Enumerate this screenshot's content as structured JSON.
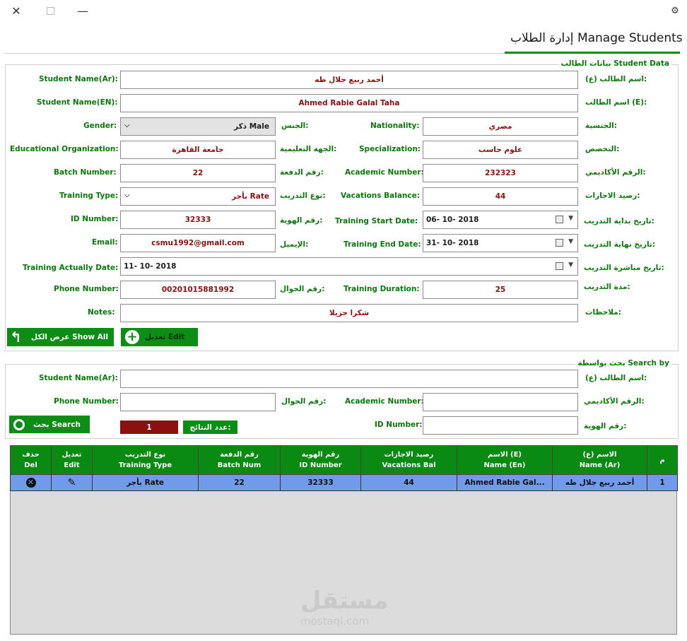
{
  "header": {
    "title": "إدارة الطلاب Manage Students"
  },
  "student_data": {
    "group_title": "بيانات الطالب Student Data",
    "name_ar": {
      "label_en": "Student Name(Ar):",
      "label_ar": "اسم الطالب (ع):",
      "value": "أحمد ربيع جلال طه"
    },
    "name_en": {
      "label_en": "Student Name(EN):",
      "label_ar": "اسم الطالب (E):",
      "value": "Ahmed Rabie Galal Taha"
    },
    "gender": {
      "label_en": "Gender:",
      "label_ar": "الجنس:",
      "value": "ذكر Male"
    },
    "nationality": {
      "label_en": "Nationality:",
      "label_ar": "الجنسية:",
      "value": "مصري"
    },
    "organization": {
      "label_en": "Educational Organization:",
      "label_ar": "الجهة التعليمية:",
      "value": "جامعة القاهرة"
    },
    "specialization": {
      "label_en": "Specialization:",
      "label_ar": "التخصص:",
      "value": "علوم حاسب"
    },
    "batch": {
      "label_en": "Batch Number:",
      "label_ar": "رقم الدفعة:",
      "value": "22"
    },
    "academic": {
      "label_en": "Academic Number:",
      "label_ar": "الرقم الأكاديمي:",
      "value": "232323"
    },
    "training_type": {
      "label_en": "Training Type:",
      "label_ar": "نوع التدريب:",
      "value": "بأجر Rate"
    },
    "vacations": {
      "label_en": "Vacations Balance:",
      "label_ar": "رصيد الاجازات:",
      "value": "44"
    },
    "id_number": {
      "label_en": "ID Number:",
      "label_ar": "رقم الهوية:",
      "value": "32333"
    },
    "start_date": {
      "label_en": "Training Start Date:",
      "label_ar": "تاريخ بداية التدريب:",
      "value": "06- 10- 2018"
    },
    "email": {
      "label_en": "Email:",
      "label_ar": "الإيميل:",
      "value": "csmu1992@gmail.com"
    },
    "end_date": {
      "label_en": "Training End Date:",
      "label_ar": "تاريخ نهاية التدريب:",
      "value": "31- 10- 2018"
    },
    "actual_date": {
      "label_en": "Training Actually Date:",
      "label_ar": "تاريخ مباشرة التدريب:",
      "value": "11- 10- 2018"
    },
    "phone": {
      "label_en": "Phone Number:",
      "label_ar": "رقم الجوال:",
      "value": "00201015881992"
    },
    "duration": {
      "label_en": "Training Duration:",
      "label_ar": "مدة التدريب:",
      "value": "25"
    },
    "notes": {
      "label_en": "Notes:",
      "label_ar": "ملاحظات:",
      "value": "شكرا جزيلا"
    },
    "show_all_label": "عرض الكل Show All",
    "edit_label": "تعديل Edit"
  },
  "search": {
    "group_title": "بحث بواسطة Search by",
    "name_ar": {
      "label_en": "Student Name(Ar):",
      "label_ar": "اسم الطالب (ع):",
      "value": ""
    },
    "phone": {
      "label_en": "Phone Number:",
      "label_ar": "رقم الجوال:",
      "value": ""
    },
    "academic": {
      "label_en": "Academic Number:",
      "label_ar": "الرقم الأكاديمي:",
      "value": ""
    },
    "id_number": {
      "label_en": "ID Number:",
      "label_ar": "رقم الهوية:",
      "value": ""
    },
    "search_label": "بحث Search",
    "results_label": "عدد النتائج:",
    "results_count": "1"
  },
  "grid": {
    "headers": [
      {
        "ar": "حذف",
        "en": "Del"
      },
      {
        "ar": "تعديل",
        "en": "Edit"
      },
      {
        "ar": "نوع التدريب",
        "en": "Training Type"
      },
      {
        "ar": "رقم الدفعة",
        "en": "Batch Num"
      },
      {
        "ar": "رقم الهوية",
        "en": "ID Number"
      },
      {
        "ar": "رصيد الاجازات",
        "en": "Vacations Bal"
      },
      {
        "ar": "الاسم (E)",
        "en": "Name (En)"
      },
      {
        "ar": "الاسم (ع)",
        "en": "Name (Ar)"
      },
      {
        "ar": "م",
        "en": ""
      }
    ],
    "rows": [
      {
        "training_type": "بأجر Rate",
        "batch": "22",
        "id": "32333",
        "vacations": "44",
        "name_en": "Ahmed Rabie Gal...",
        "name_ar": "أحمد ربيع جلال طه",
        "num": "1"
      }
    ]
  },
  "watermark": {
    "ar": "مستقل",
    "en": "mostaql.com"
  }
}
